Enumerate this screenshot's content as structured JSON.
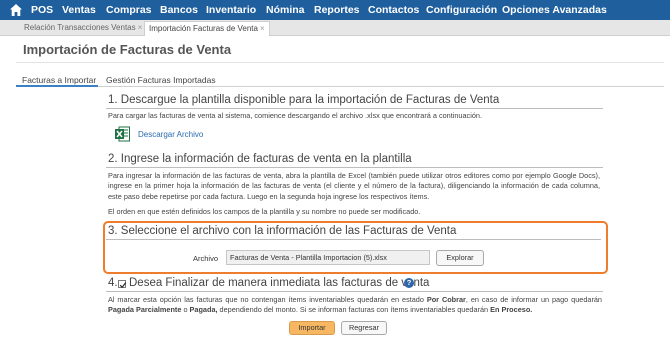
{
  "nav": {
    "items": [
      "POS",
      "Ventas",
      "Compras",
      "Bancos",
      "Inventario",
      "Nómina",
      "Reportes",
      "Contactos",
      "Configuración",
      "Opciones Avanzadas"
    ]
  },
  "doc_tabs": [
    {
      "label": "Relación Transacciones Ventas"
    },
    {
      "label": "Importación Facturas de Venta"
    }
  ],
  "page_title": "Importación de Facturas de Venta",
  "subtabs": [
    "Facturas a Importar",
    "Gestión Facturas Importadas"
  ],
  "step1": {
    "heading": "1. Descargue la plantilla disponible para la importación de Facturas de Venta",
    "text": "Para cargar las facturas de venta al sistema, comience descargando el archivo .xlsx que encontrará a continuación.",
    "link": "Descargar Archivo"
  },
  "step2": {
    "heading": "2. Ingrese la información de facturas de venta en la plantilla",
    "text": "Para ingresar la información de las facturas de venta, abra la plantilla de Excel (también puede utilizar otros editores como por ejemplo Google Docs), ingrese en la primer hoja la información de las facturas de venta (el cliente y el número de la factura), diligenciando la información de cada columna, este paso debe repetirse por cada factura. Luego en la segunda hoja ingrese los respectivos ítems.",
    "note": "El orden en que estén definidos los campos de la plantilla y su nombre no puede ser modificado."
  },
  "step3": {
    "heading": "3. Seleccione el archivo con la información de las Facturas de Venta",
    "file_label": "Archivo",
    "file_value": "Facturas de Venta - Plantilla Importacion (5).xlsx",
    "browse_label": "Explorar"
  },
  "step4": {
    "heading": "4.",
    "heading_text": "Desea Finalizar de manera inmediata las facturas de venta",
    "checked": true,
    "text_parts": {
      "a": "Al marcar esta opción las facturas que no contengan ítems inventariables quedarán en estado ",
      "b": "Por Cobrar",
      "c": ", en caso de informar un pago quedarán ",
      "d": "Pagada Parcialmente",
      "e": " o ",
      "f": "Pagada,",
      "g": " dependiendo del monto.  Si se informan facturas con ítems inventariables quedarán ",
      "h": "En Proceso."
    }
  },
  "buttons": {
    "import": "Importar",
    "back": "Regresar"
  },
  "colors": {
    "nav_bg": "#1f5f9e",
    "highlight": "#ee7d2d",
    "link": "#2a6bb0",
    "import_button": "#f7b662"
  }
}
